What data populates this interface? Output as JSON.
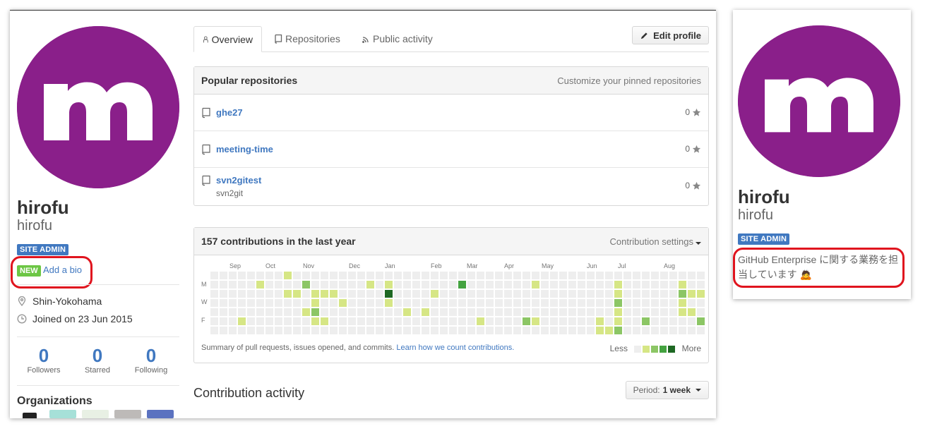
{
  "profile": {
    "fullname": "hirofu",
    "username": "hirofu",
    "site_admin_badge": "SITE ADMIN",
    "new_badge": "NEW",
    "add_bio": "Add a bio",
    "location": "Shin-Yokohama",
    "joined": "Joined on 23 Jun 2015",
    "stats": [
      {
        "num": "0",
        "label": "Followers"
      },
      {
        "num": "0",
        "label": "Starred"
      },
      {
        "num": "0",
        "label": "Following"
      }
    ],
    "organizations_heading": "Organizations",
    "avatar_letter": "m",
    "avatar_color": "#8a1f8a"
  },
  "tabs": [
    {
      "label": "Overview",
      "icon": "person-icon",
      "selected": true
    },
    {
      "label": "Repositories",
      "icon": "repo-icon",
      "selected": false
    },
    {
      "label": "Public activity",
      "icon": "rss-icon",
      "selected": false
    }
  ],
  "edit_profile_label": "Edit profile",
  "popular": {
    "title": "Popular repositories",
    "customize": "Customize your pinned repositories",
    "repos": [
      {
        "name": "ghe27",
        "description": "",
        "stars": "0"
      },
      {
        "name": "meeting-time",
        "description": "",
        "stars": "0"
      },
      {
        "name": "svn2gitest",
        "description": "svn2git",
        "stars": "0"
      }
    ]
  },
  "contributions": {
    "title": "157 contributions in the last year",
    "settings": "Contribution settings",
    "months": [
      "Sep",
      "Oct",
      "Nov",
      "Dec",
      "Jan",
      "Feb",
      "Mar",
      "Apr",
      "May",
      "Jun",
      "Jul",
      "Aug"
    ],
    "days": [
      "M",
      "W",
      "F"
    ],
    "summary": "Summary of pull requests, issues opened, and commits.",
    "learn_more": "Learn how we count contributions.",
    "less": "Less",
    "more": "More",
    "colors": [
      "#eeeeee",
      "#d6e685",
      "#8cc665",
      "#44a340",
      "#1e6823"
    ]
  },
  "activity": {
    "title": "Contribution activity",
    "period_label": "Period:",
    "period_value": "1 week"
  },
  "side_profile": {
    "fullname": "hirofu",
    "username": "hirofu",
    "site_admin_badge": "SITE ADMIN",
    "bio_line1": "GitHub Enterprise に関する業務を担",
    "bio_line2": "当しています",
    "bio_emoji": "🙇"
  },
  "highlight_color": "#e0141e"
}
